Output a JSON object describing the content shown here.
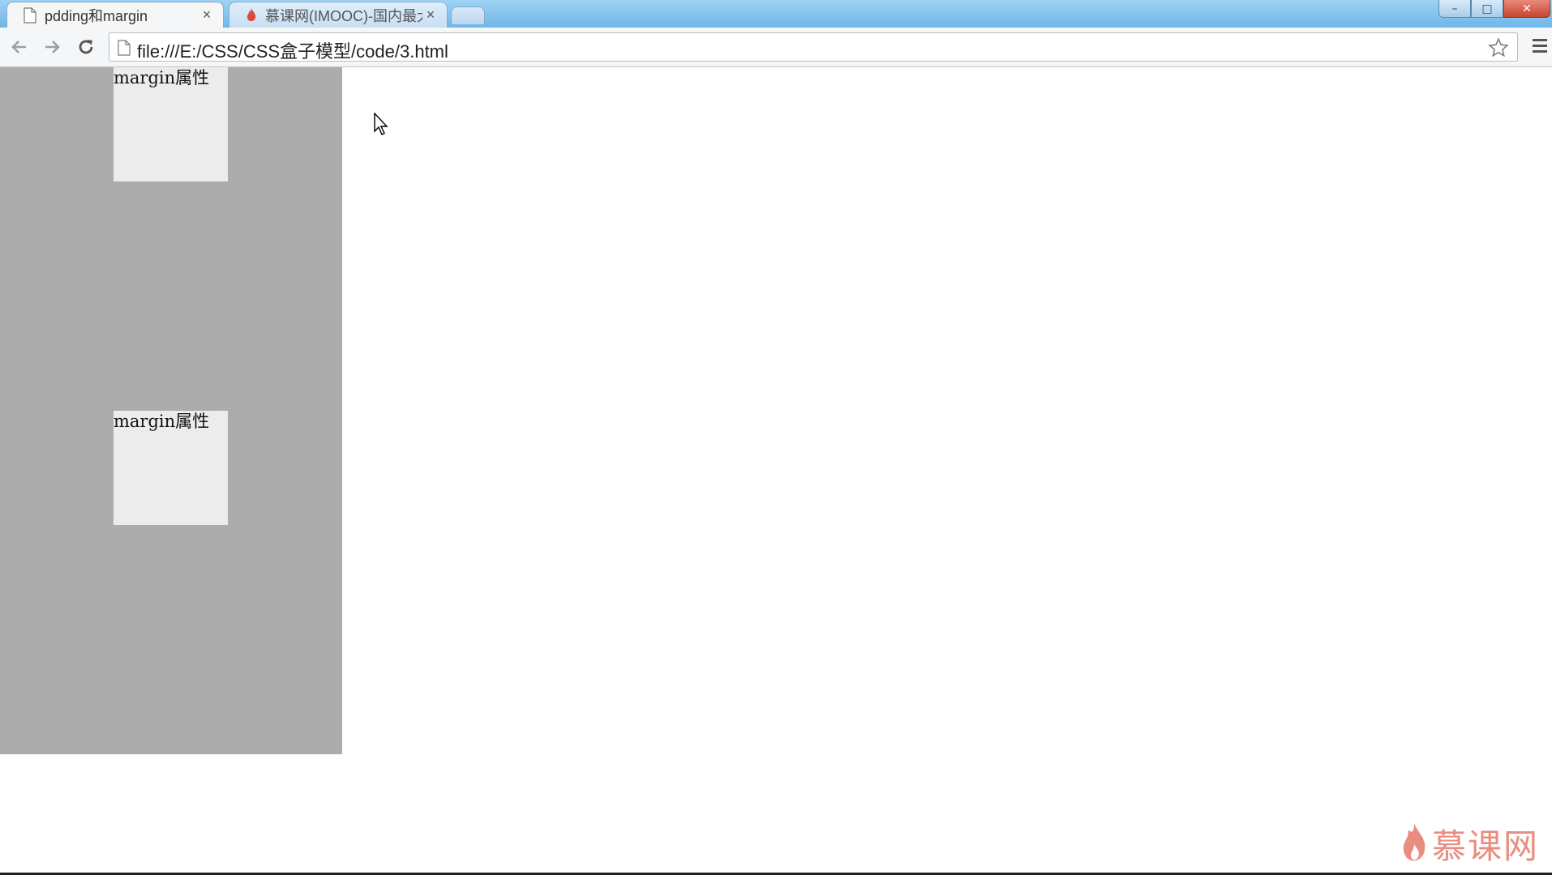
{
  "browser": {
    "tabs": [
      {
        "title": "pdding和margin",
        "active": true,
        "icon": "page-icon"
      },
      {
        "title": "慕课网(IMOOC)-国内最大",
        "active": false,
        "icon": "flame-icon"
      }
    ],
    "tab_close_glyph": "×",
    "address_url": "file:///E:/CSS/CSS盒子模型/code/3.html",
    "window_controls": {
      "minimize": "–",
      "maximize": "□",
      "close": "✕"
    }
  },
  "page": {
    "boxes": [
      {
        "text": "margin属性"
      },
      {
        "text": "margin属性"
      }
    ],
    "colors": {
      "container_bg": "#acacac",
      "box_bg": "#ececec",
      "page_bg": "#ffffff"
    }
  },
  "watermark": {
    "text": "慕课网",
    "icon": "flame-icon",
    "color": "#e98d80"
  }
}
